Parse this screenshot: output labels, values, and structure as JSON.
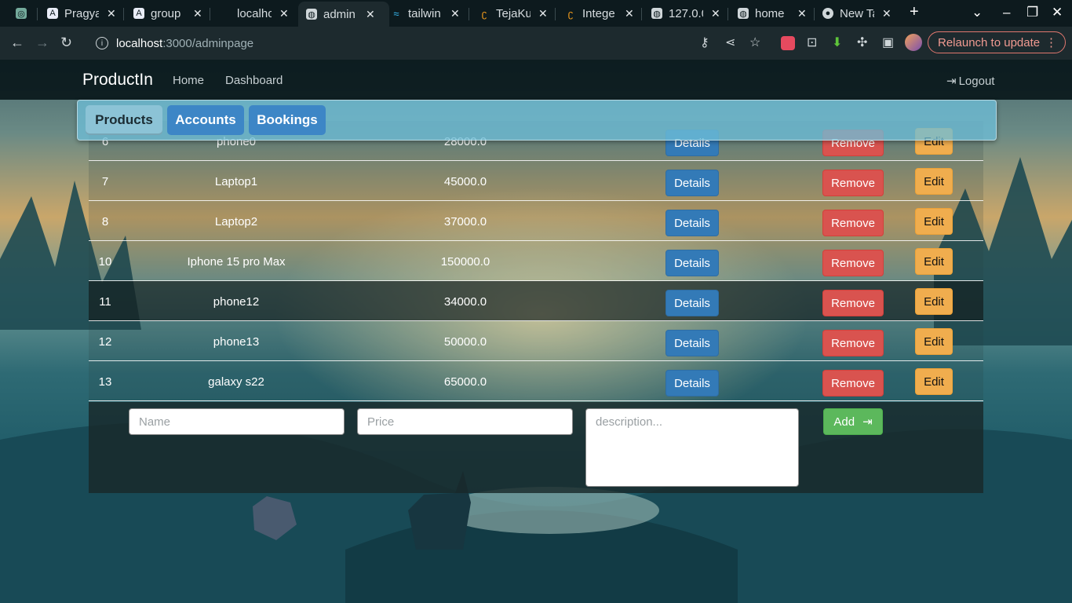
{
  "browser": {
    "tabs": [
      {
        "title": "",
        "icon": "openai-icon",
        "active": false
      },
      {
        "title": "Pragya",
        "icon": "doc-icon",
        "active": false
      },
      {
        "title": "group",
        "icon": "doc-icon",
        "active": false
      },
      {
        "title": "localho",
        "icon": "blank-icon",
        "active": false
      },
      {
        "title": "admin",
        "icon": "globe-icon",
        "active": true
      },
      {
        "title": "tailwin",
        "icon": "tailwind-icon",
        "active": false
      },
      {
        "title": "TejaKu",
        "icon": "leetcode-icon",
        "active": false
      },
      {
        "title": "Intege",
        "icon": "leetcode-icon",
        "active": false
      },
      {
        "title": "127.0.0",
        "icon": "globe-icon",
        "active": false
      },
      {
        "title": "home",
        "icon": "globe-icon",
        "active": false
      },
      {
        "title": "New Ta",
        "icon": "chrome-icon",
        "active": false
      }
    ],
    "new_tab": "+",
    "url_host": "localhost",
    "url_path": ":3000/adminpage",
    "relaunch_label": "Relaunch to update"
  },
  "app": {
    "brand": "ProductIn",
    "nav": {
      "home": "Home",
      "dashboard": "Dashboard",
      "logout": "Logout"
    },
    "tabs": {
      "products": "Products",
      "accounts": "Accounts",
      "bookings": "Bookings"
    },
    "row_buttons": {
      "details": "Details",
      "remove": "Remove",
      "edit": "Edit"
    },
    "products": [
      {
        "id": "6",
        "name": "phone0",
        "price": "28000.0"
      },
      {
        "id": "7",
        "name": "Laptop1",
        "price": "45000.0"
      },
      {
        "id": "8",
        "name": "Laptop2",
        "price": "37000.0"
      },
      {
        "id": "10",
        "name": "Iphone 15 pro Max",
        "price": "150000.0"
      },
      {
        "id": "11",
        "name": "phone12",
        "price": "34000.0"
      },
      {
        "id": "12",
        "name": "phone13",
        "price": "50000.0"
      },
      {
        "id": "13",
        "name": "galaxy s22",
        "price": "65000.0"
      }
    ],
    "form": {
      "name_placeholder": "Name",
      "price_placeholder": "Price",
      "description_placeholder": "description...",
      "add_label": "Add"
    }
  }
}
